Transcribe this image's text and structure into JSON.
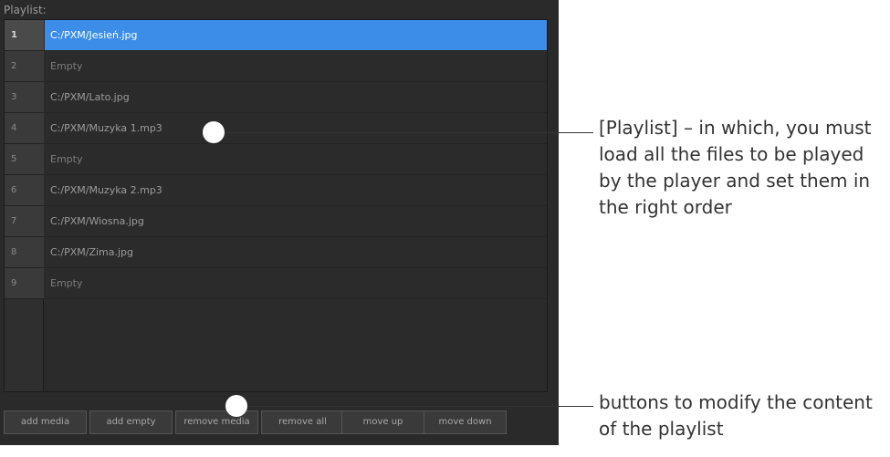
{
  "playlist": {
    "label": "Playlist:",
    "rows": [
      {
        "num": "1",
        "name": "C:/PXM/Jesień.jpg"
      },
      {
        "num": "2",
        "name": "Empty"
      },
      {
        "num": "3",
        "name": "C:/PXM/Lato.jpg"
      },
      {
        "num": "4",
        "name": "C:/PXM/Muzyka 1.mp3"
      },
      {
        "num": "5",
        "name": "Empty"
      },
      {
        "num": "6",
        "name": "C:/PXM/Muzyka 2.mp3"
      },
      {
        "num": "7",
        "name": "C:/PXM/Wiosna.jpg"
      },
      {
        "num": "8",
        "name": "C:/PXM/Zima.jpg"
      },
      {
        "num": "9",
        "name": "Empty"
      }
    ],
    "selected_row": "1",
    "buttons": {
      "add_media": "add media",
      "add_empty": "add empty",
      "remove_media": "remove media",
      "remove_all": "remove all",
      "move_up": "move up",
      "move_down": "move down"
    }
  },
  "annotations": {
    "playlist_title": "[Playlist]",
    "playlist_desc": " – in which, you must load all the files to be played by the player and set them in the right order",
    "buttons_desc": "buttons to modify the content of the playlist"
  },
  "colors": {
    "selection": "#3b8de8",
    "panel": "#2a2a2a"
  }
}
